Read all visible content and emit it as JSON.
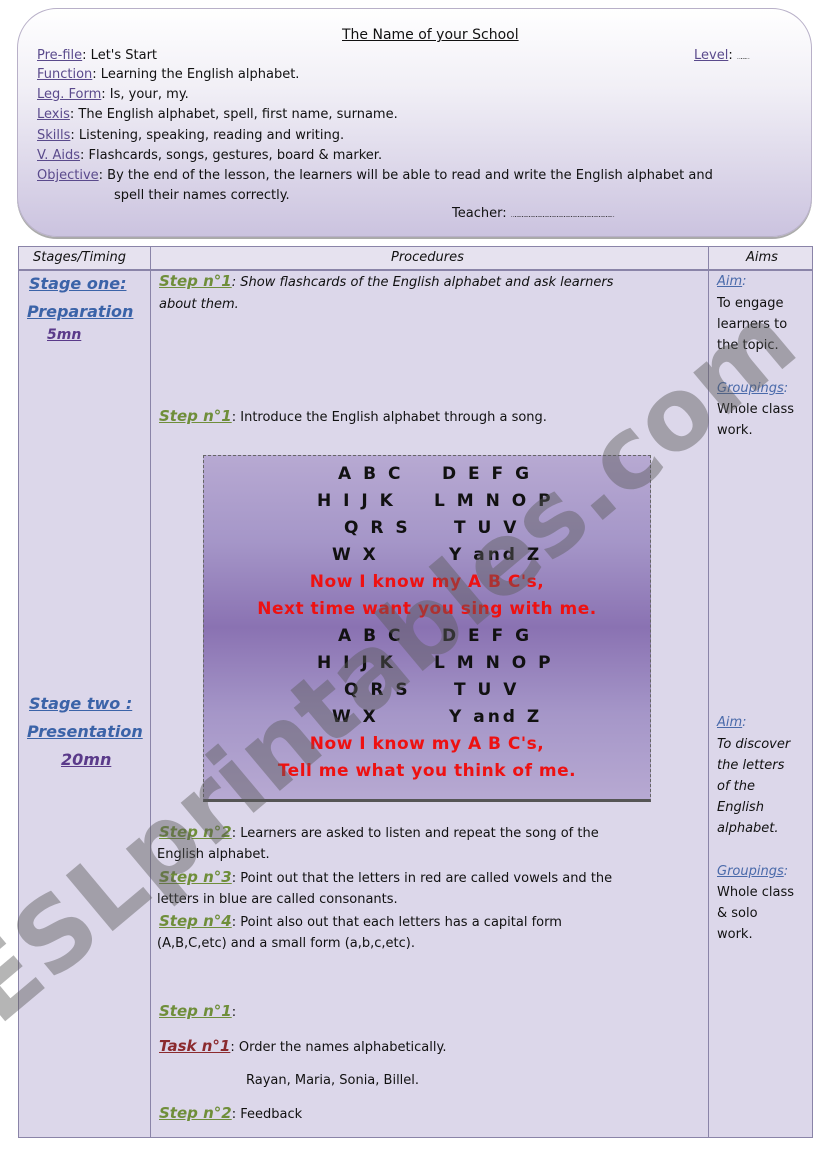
{
  "header": {
    "title": "The Name of your School",
    "fields": [
      {
        "label": "Pre-file",
        "value": ": Let's Start"
      },
      {
        "label": "Function",
        "value": ": Learning the English alphabet."
      },
      {
        "label": "Leg. Form",
        "value": ": Is, your, my."
      },
      {
        "label": "Lexis",
        "value": ": The English alphabet, spell, first name, surname."
      },
      {
        "label": "Skills",
        "value": ": Listening, speaking, reading and writing."
      },
      {
        "label": "V. Aids",
        "value": ": Flashcards, songs, gestures, board & marker."
      },
      {
        "label": "Objective",
        "value": ": By the end of the lesson, the learners will be able to read and write the English alphabet and"
      }
    ],
    "objective_cont": "spell their names correctly.",
    "level_label": "Level",
    "level_value": ": ………",
    "teacher": "Teacher: ……………………………………………………………………………"
  },
  "table": {
    "headers": [
      "Stages/Timing",
      "Procedures",
      "Aims"
    ],
    "stage1": {
      "name1": "Stage one:",
      "name2": "Preparation",
      "time": "5mn"
    },
    "stage2": {
      "name1": "Stage two :",
      "name2": "Presentation",
      "time": "20mn"
    },
    "procedures": {
      "s1_label": "Step n°1",
      "s1_text": ": Show flashcards of the English alphabet and ask learners",
      "s1_cont": "about them.",
      "s2_label": "Step n°1",
      "s2_text": ": Introduce the English alphabet through a song.",
      "p2_label": "Step n°2",
      "p2_text": ": Learners are asked to listen and repeat the song of the",
      "p2_cont": "English alphabet.",
      "p3_label": "Step n°3",
      "p3_text": ": Point out that the letters in red are called vowels and the",
      "p3_cont": "letters in blue are called consonants.",
      "p4_label": "Step n°4",
      "p4_text": ": Point also out that each letters has a capital form",
      "p4_cont": "(A,B,C,etc) and a small form (a,b,c,etc).",
      "q1_label": "Step n°1",
      "q1_text": ":",
      "t1_label": "Task n°1",
      "t1_text": ": Order the names alphabetically.",
      "names": "Rayan, Maria, Sonia, Billel.",
      "q2_label": "Step n°2",
      "q2_text": ": Feedback"
    },
    "song": {
      "letters": [
        [
          "A B C",
          "D E F G"
        ],
        [
          "H I J K",
          "L M N O P"
        ],
        [
          "Q R S",
          "T U V"
        ],
        [
          "W X",
          "Y and Z"
        ],
        [
          "A B C",
          "D E F G"
        ],
        [
          "H I J K",
          "L M N O P"
        ],
        [
          "Q R S",
          "T U V"
        ],
        [
          "W X",
          "Y and Z"
        ]
      ],
      "red": [
        "Now I know my A B C's,",
        "Next time want you sing with me.",
        "Now I know my A B C's,",
        "Tell me what you think of me."
      ]
    },
    "aims1": {
      "aim_label": "Aim",
      "aim_lines": [
        "To engage",
        "learners to",
        "the topic."
      ],
      "group_label": "Groupings",
      "group_lines": [
        "Whole class",
        "work."
      ]
    },
    "aims2": {
      "aim_label": "Aim",
      "aim_lines": [
        "To discover",
        "the letters",
        "of the",
        "English",
        "alphabet."
      ],
      "group_label": "Groupings",
      "group_lines": [
        "Whole class",
        "& solo",
        "work."
      ]
    }
  },
  "watermark": "ESLprintables.com",
  "colors": {
    "label": "#5a4a8c",
    "stage": "#3b63a8",
    "step": "#6f8e3a",
    "task": "#8b2a2e",
    "vowels": "#ee1111"
  }
}
